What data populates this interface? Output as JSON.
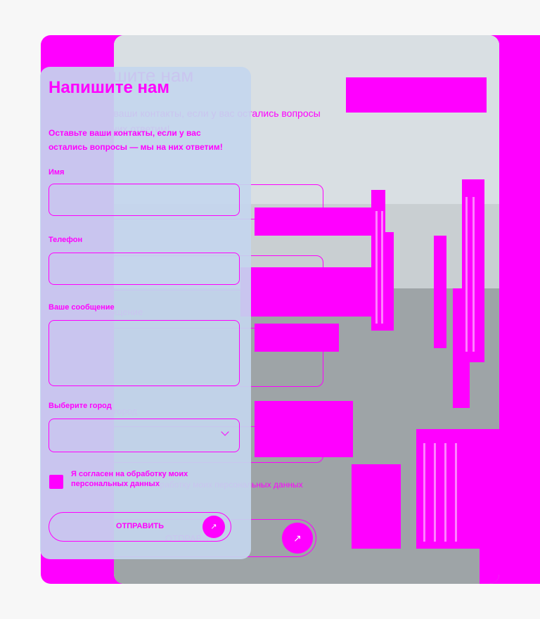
{
  "form": {
    "title": "Напишите нам",
    "subtitle": "Оставьте ваши контакты, если у вас остались вопросы — мы на них ответим!",
    "name_label": "Имя",
    "name_value": "",
    "phone_label": "Телефон",
    "phone_placeholder": "",
    "message_label": "Ваше сообщение",
    "message_value": "",
    "city_label": "Выберите город",
    "city_value": "",
    "consent_text": "Я согласен на обработку моих персональных данных",
    "submit_label": "ОТПРАВИТЬ",
    "submit_icon": "↗"
  },
  "colors": {
    "accent": "#ff00ff",
    "card_background": "#c4d6ee",
    "photo_overlay": "#ff00ff"
  },
  "icons": {
    "chevron": "chevron-down-icon",
    "arrow": "arrow-up-right-icon"
  }
}
